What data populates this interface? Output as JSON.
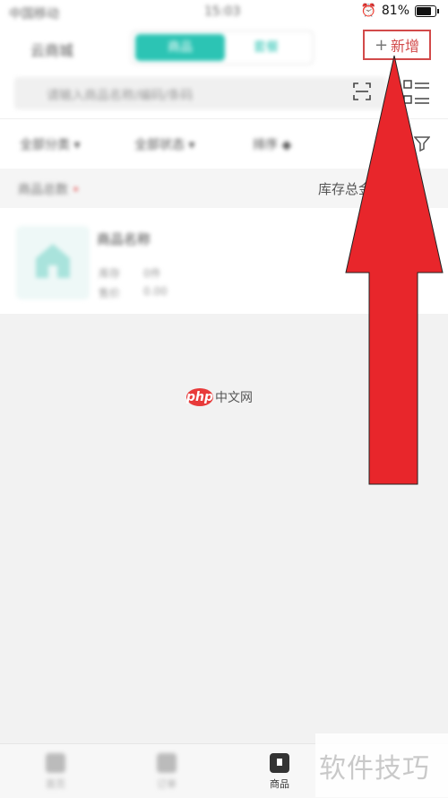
{
  "status_bar": {
    "carrier": "中国移动",
    "time": "15:03",
    "battery": "81%"
  },
  "header": {
    "title": "云商城",
    "tabs": [
      {
        "label": "商品"
      },
      {
        "label": "套餐"
      }
    ],
    "add_label": "新增",
    "add_plus": "+"
  },
  "search": {
    "placeholder": "请输入商品名称/编码/条码"
  },
  "filters": [
    {
      "label": "全部分类 ▾"
    },
    {
      "label": "全部状态 ▾"
    },
    {
      "label": "排序 ◆"
    }
  ],
  "summary": {
    "left": "商品总数",
    "left_dot": "•",
    "right": "库存总金"
  },
  "product": {
    "name": "商品名称",
    "meta": [
      "库存",
      "0件",
      "售价",
      "0.00"
    ]
  },
  "watermark": {
    "logo": "php",
    "text": "中文网"
  },
  "bottom_nav": [
    {
      "label": "首页"
    },
    {
      "label": "订单"
    },
    {
      "label": "商品"
    }
  ],
  "corner_watermark": "软件技巧",
  "colors": {
    "accent": "#2cc4b4",
    "highlight": "#d24a4a",
    "arrow": "#e8262b"
  }
}
